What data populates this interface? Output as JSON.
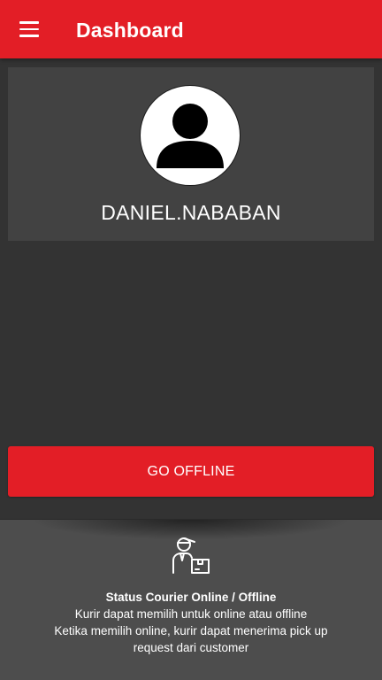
{
  "header": {
    "title": "Dashboard",
    "menu_icon": "hamburger-menu-icon",
    "background_color": "#e31e26"
  },
  "profile": {
    "avatar_icon": "user-avatar-icon",
    "username": "DANIEL.NABABAN"
  },
  "status_button": {
    "label": "GO OFFLINE",
    "color": "#e31e26"
  },
  "info": {
    "icon": "courier-package-icon",
    "title": "Status Courier Online / Offline",
    "lines": [
      "Kurir dapat memilih untuk online atau offline",
      "Ketika memilih online, kurir dapat menerima pick up",
      "request dari customer"
    ]
  }
}
